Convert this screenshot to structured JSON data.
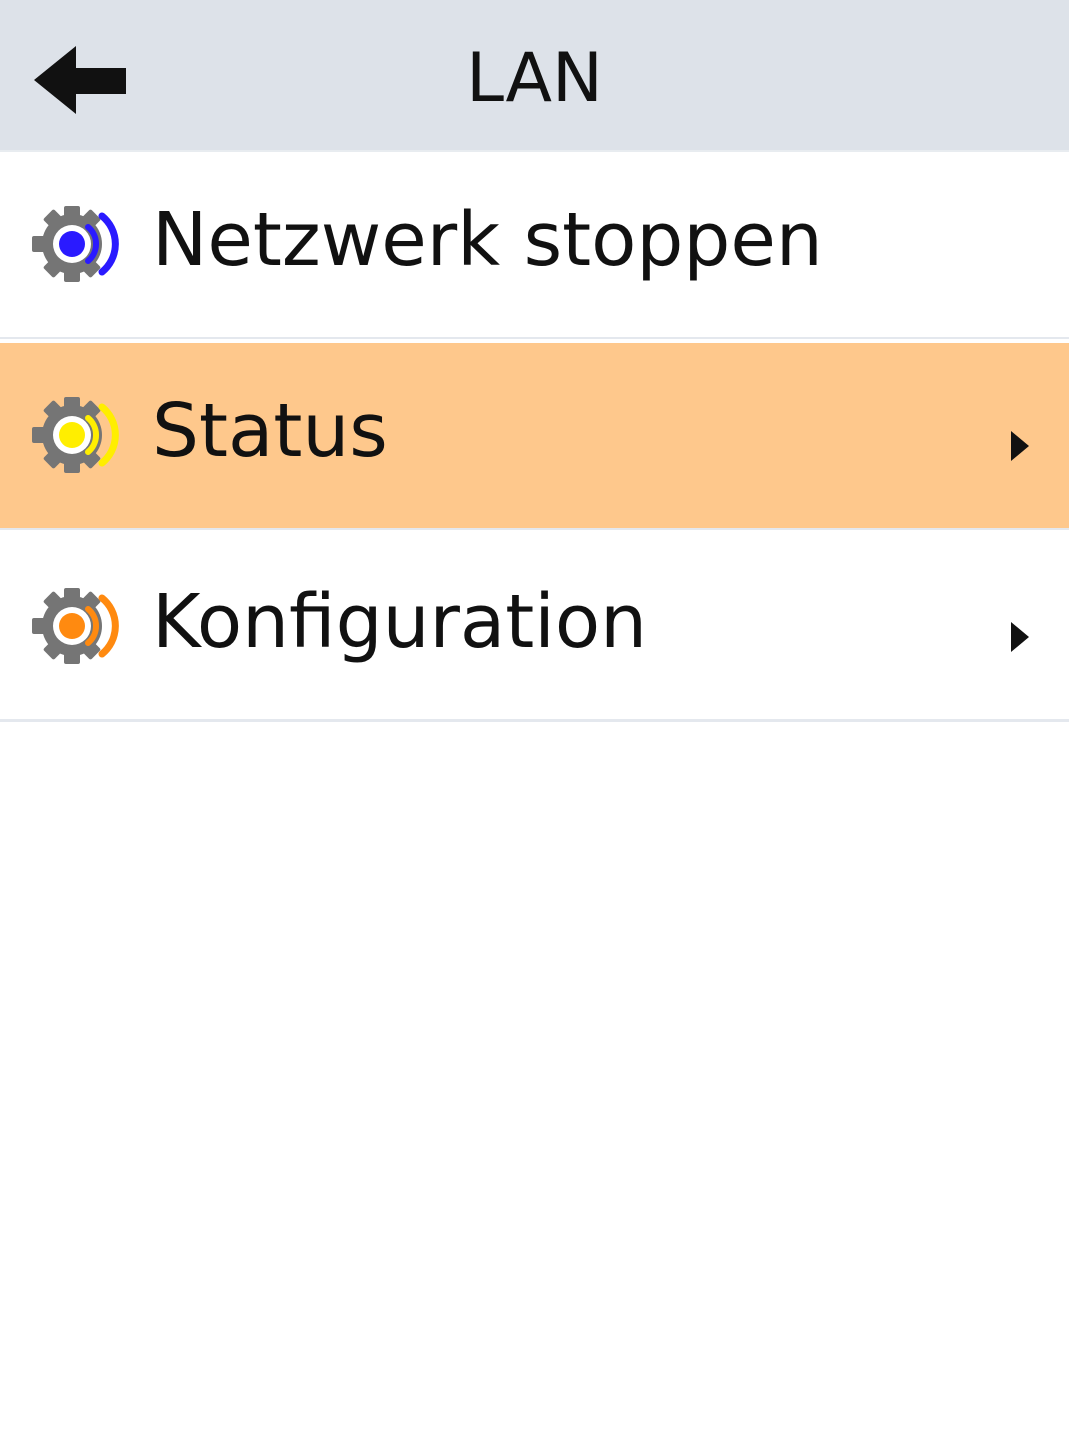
{
  "header": {
    "title": "LAN",
    "back_icon": "arrow-left-icon"
  },
  "menu": {
    "items": [
      {
        "label": "Netzwerk stoppen",
        "icon": "network-gear-icon",
        "icon_color": "#2a1aff",
        "selected": false,
        "has_submenu": false
      },
      {
        "label": "Status",
        "icon": "network-gear-icon",
        "icon_color": "#ffee00",
        "selected": true,
        "has_submenu": true
      },
      {
        "label": "Konfiguration",
        "icon": "network-gear-icon",
        "icon_color": "#ff8a10",
        "selected": false,
        "has_submenu": true
      }
    ]
  },
  "colors": {
    "header_bg": "#dde2e9",
    "selected_bg": "#fec88c",
    "gear": "#757575",
    "text": "#111111"
  }
}
